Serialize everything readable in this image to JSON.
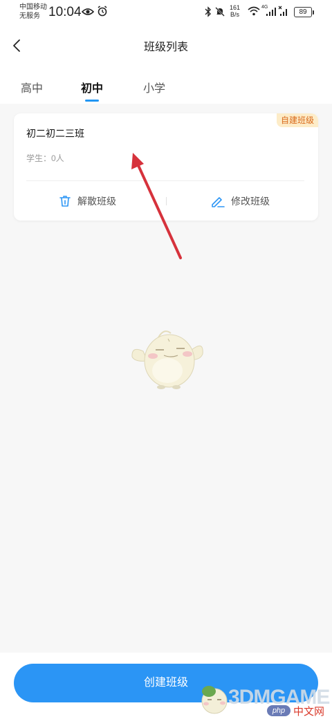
{
  "status_bar": {
    "carrier_line1": "中国移动",
    "carrier_line2": "无服务",
    "time": "10:04",
    "net_speed_value": "161",
    "net_speed_unit": "B/s",
    "network_type": "4G",
    "battery": "89"
  },
  "header": {
    "title": "班级列表"
  },
  "tabs": [
    {
      "label": "高中",
      "active": false
    },
    {
      "label": "初中",
      "active": true
    },
    {
      "label": "小学",
      "active": false
    }
  ],
  "class_card": {
    "name": "初二初二三班",
    "badge": "自建班级",
    "students": "学生：0人",
    "actions": {
      "dissolve": "解散班级",
      "edit": "修改班级"
    }
  },
  "bottom": {
    "create_button": "创建班级"
  },
  "watermark": {
    "brand": "3DMGAME",
    "php_label": "php",
    "site": "中文网"
  },
  "colors": {
    "accent": "#2b95f5",
    "badge_bg": "#fdecc8",
    "badge_text": "#d96a1b",
    "annotation_arrow": "#d6323c"
  }
}
